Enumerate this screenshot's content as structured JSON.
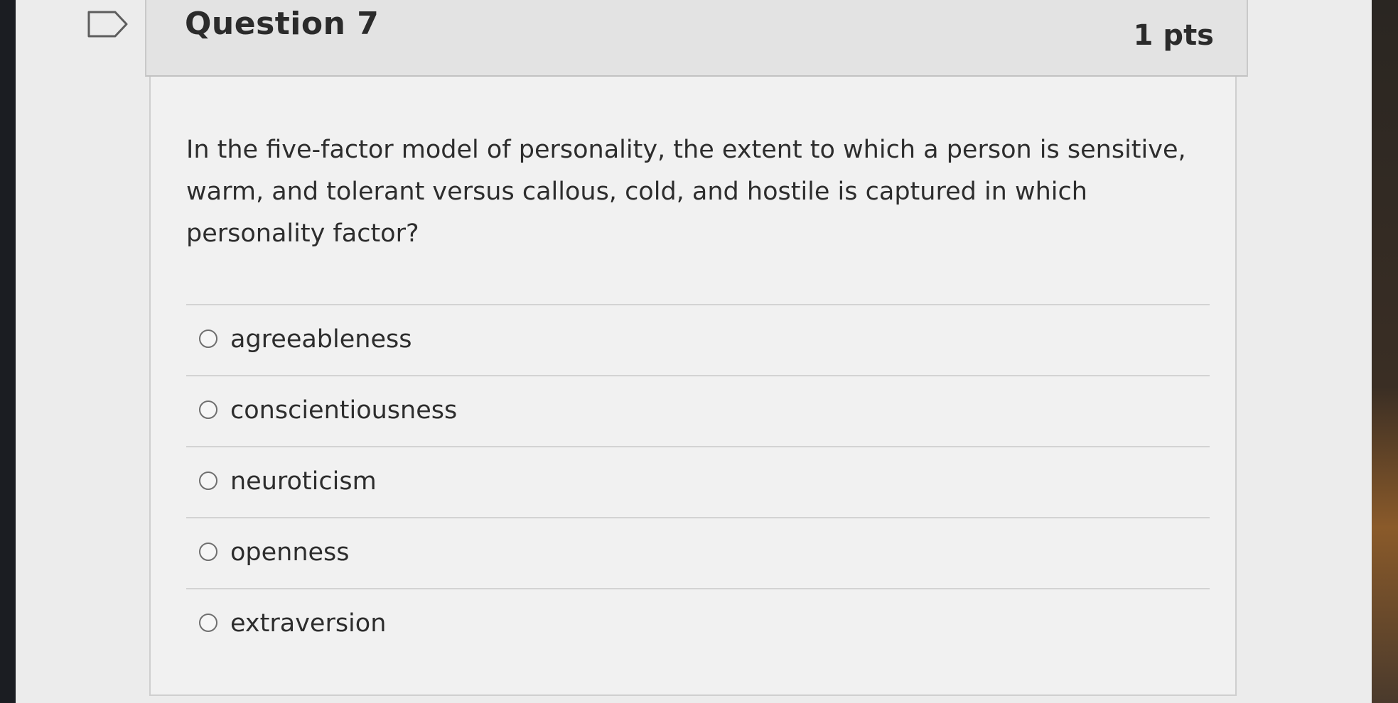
{
  "question": {
    "title": "Question 7",
    "points": "1 pts",
    "text": "In the five-factor model of personality, the extent to which a person is sensitive, warm, and tolerant versus callous, cold, and hostile is captured in which personality factor?",
    "flag_icon": "flag-question-icon"
  },
  "answers": [
    {
      "label": "agreeableness",
      "selected": false
    },
    {
      "label": "conscientiousness",
      "selected": false
    },
    {
      "label": "neuroticism",
      "selected": false
    },
    {
      "label": "openness",
      "selected": false
    },
    {
      "label": "extraversion",
      "selected": false
    }
  ]
}
